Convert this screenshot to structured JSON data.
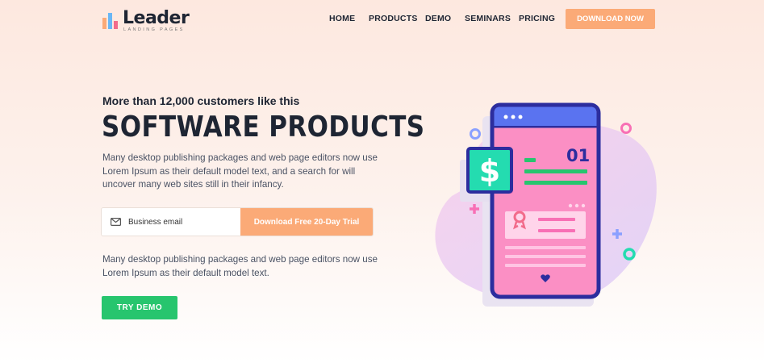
{
  "brand": {
    "name": "Leader",
    "tagline": "LANDING PAGES",
    "bar_colors": [
      "#fbaa77",
      "#6ab7f5",
      "#f26b8b"
    ]
  },
  "nav": {
    "items": [
      "HOME",
      "PRODUCTS",
      "DEMO",
      "SEMINARS",
      "PRICING"
    ],
    "cta": "DOWNLOAD NOW"
  },
  "hero": {
    "eyebrow": "More than 12,000 customers like this",
    "headline": "SOFTWARE PRODUCTS",
    "description": "Many desktop publishing packages and web page editors now use Lorem Ipsum as their default model text, and a search for will uncover many web sites still in their infancy.",
    "email_placeholder": "Business email",
    "trial_button": "Download Free 20-Day Trial",
    "secondary_text": "Many desktop publishing packages and web page editors now use Lorem Ipsum as their default model text.",
    "demo_button": "TRY DEMO"
  },
  "illustration": {
    "phone_number_label": "01",
    "dollar_symbol": "$",
    "icons": [
      "phone-icon",
      "dollar-card-icon",
      "award-ribbon-icon",
      "heart-icon",
      "mail-icon"
    ]
  },
  "colors": {
    "accent": "#fbaa77",
    "green": "#27c56e",
    "dark": "#1e2533",
    "phone_pink": "#fb8fc4",
    "phone_blue": "#5a73f0",
    "navy": "#2c2d9e"
  }
}
